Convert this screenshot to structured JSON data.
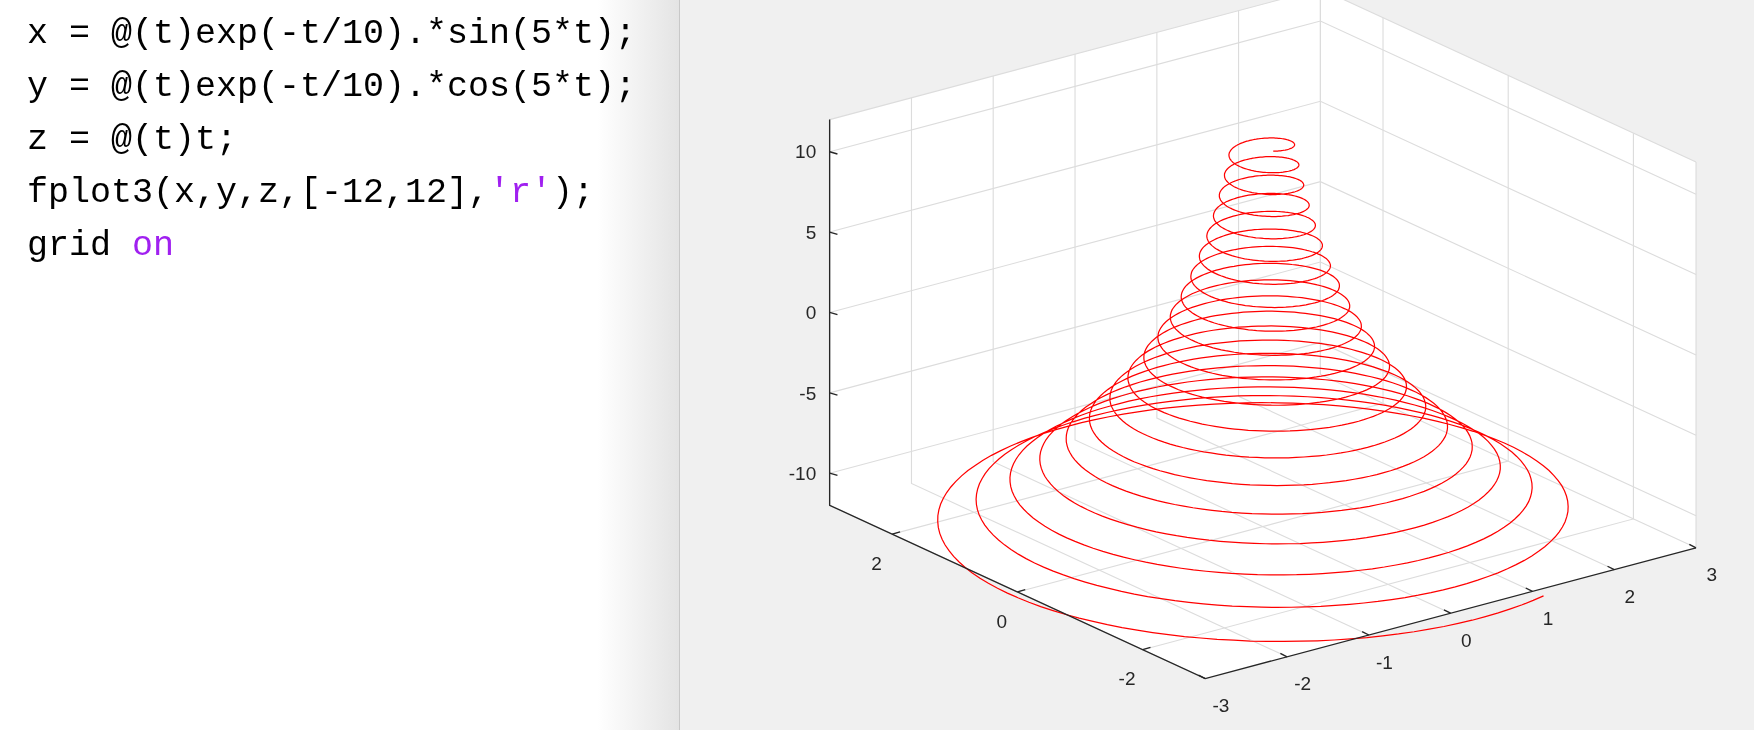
{
  "editor": {
    "lines": [
      [
        {
          "text": "x = @(t)exp(-t/10).*sin(5*t);",
          "kind": "code"
        }
      ],
      [
        {
          "text": "y = @(t)exp(-t/10).*cos(5*t);",
          "kind": "code"
        }
      ],
      [
        {
          "text": "z = @(t)t;",
          "kind": "code"
        }
      ],
      [
        {
          "text": "fplot3(x,y,z,[-12,12],",
          "kind": "code"
        },
        {
          "text": "'r'",
          "kind": "string"
        },
        {
          "text": ");",
          "kind": "code"
        }
      ],
      [
        {
          "text": "grid ",
          "kind": "code"
        },
        {
          "text": "on",
          "kind": "string"
        }
      ]
    ]
  },
  "figure": {
    "z_ticks": [
      "10",
      "5",
      "0",
      "-5",
      "-10"
    ],
    "y_ticks": [
      "2",
      "0",
      "-2"
    ],
    "x_ticks": [
      "-3",
      "-2",
      "-1",
      "0",
      "1",
      "2",
      "3"
    ]
  }
}
